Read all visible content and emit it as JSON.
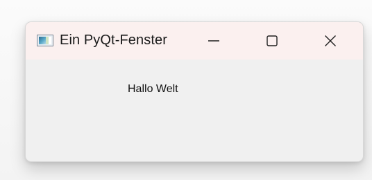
{
  "window": {
    "title": "Ein PyQt-Fenster",
    "icon": "window-app-icon",
    "controls": {
      "minimize": "minimize-icon",
      "maximize": "maximize-icon",
      "close": "close-icon"
    }
  },
  "content": {
    "label": "Hallo Welt"
  },
  "colors": {
    "titlebar": "#fbf0ef",
    "body": "#f0f0f0",
    "text": "#1a1a1a"
  }
}
